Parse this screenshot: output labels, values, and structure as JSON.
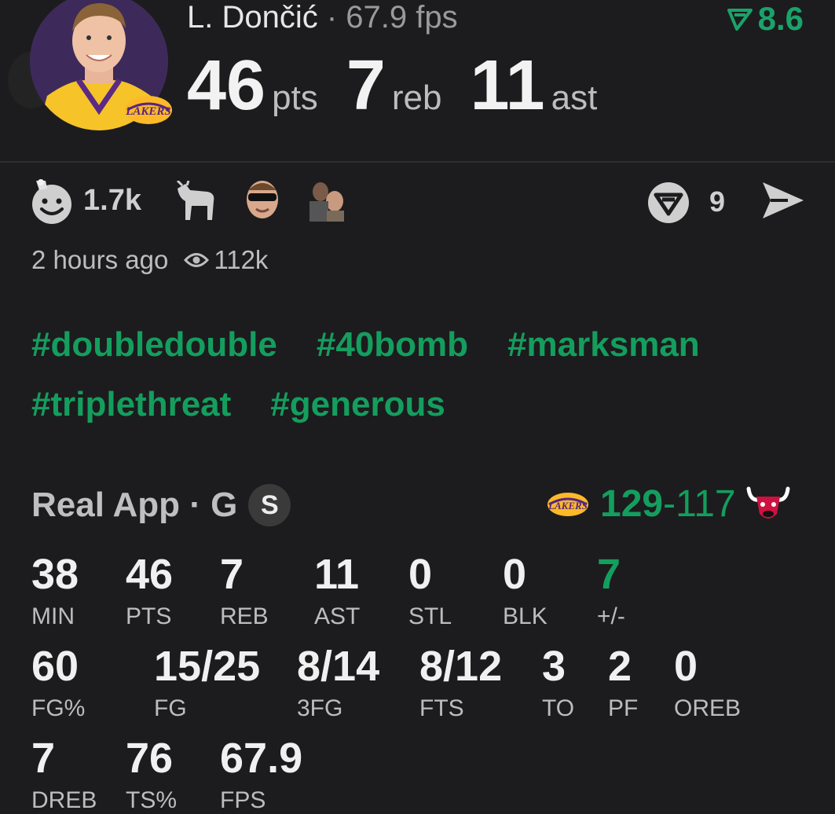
{
  "header": {
    "player_name": "L. Dončić",
    "fps_text": "· 67.9 fps",
    "rating": "8.6",
    "colors": {
      "accent": "#149e5e",
      "team_purple": "#552583",
      "team_gold": "#fdb927"
    },
    "statline": [
      {
        "value": "46",
        "unit": "pts"
      },
      {
        "value": "7",
        "unit": "reb"
      },
      {
        "value": "11",
        "unit": "ast"
      }
    ]
  },
  "reactions": {
    "count": "1.7k",
    "icons": [
      "smiley-goat-icon",
      "goat-icon",
      "sunglasses-face-icon",
      "player-photo-icon"
    ],
    "comments_count": "9"
  },
  "meta": {
    "time_ago": "2 hours ago",
    "views": "112k"
  },
  "tags": [
    "#doubledouble",
    "#40bomb",
    "#marksman",
    "#triplethreat",
    "#generous"
  ],
  "game": {
    "source": "Real App · G",
    "badge": "S",
    "score_home": "129",
    "score_sep": "-",
    "score_away": "117"
  },
  "box_score": {
    "row1": [
      {
        "value": "38",
        "label": "MIN"
      },
      {
        "value": "46",
        "label": "PTS"
      },
      {
        "value": "7",
        "label": "REB"
      },
      {
        "value": "11",
        "label": "AST"
      },
      {
        "value": "0",
        "label": "STL"
      },
      {
        "value": "0",
        "label": "BLK"
      },
      {
        "value": "7",
        "label": "+/-"
      }
    ],
    "row2": [
      {
        "value": "60",
        "label": "FG%"
      },
      {
        "value": "15/25",
        "label": "FG"
      },
      {
        "value": "8/14",
        "label": "3FG"
      },
      {
        "value": "8/12",
        "label": "FTS"
      },
      {
        "value": "3",
        "label": "TO"
      },
      {
        "value": "2",
        "label": "PF"
      },
      {
        "value": "0",
        "label": "OREB"
      }
    ],
    "row3": [
      {
        "value": "7",
        "label": "DREB"
      },
      {
        "value": "76",
        "label": "TS%"
      },
      {
        "value": "67.9",
        "label": "FPS"
      }
    ]
  }
}
